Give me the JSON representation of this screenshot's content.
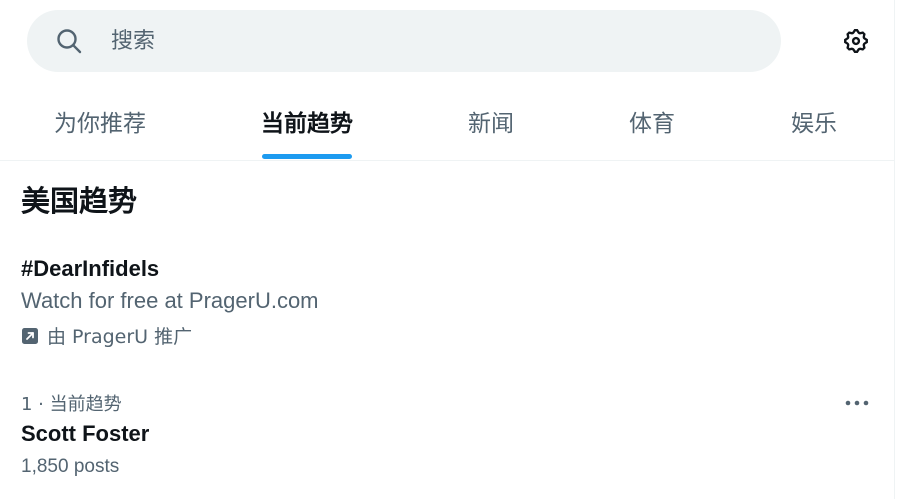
{
  "search": {
    "placeholder": "搜索",
    "icon": "search-icon"
  },
  "settings": {
    "icon": "gear-icon"
  },
  "tabs": [
    {
      "label": "为你推荐",
      "active": false
    },
    {
      "label": "当前趋势",
      "active": true
    },
    {
      "label": "新闻",
      "active": false
    },
    {
      "label": "体育",
      "active": false
    },
    {
      "label": "娱乐",
      "active": false
    }
  ],
  "section": {
    "title": "美国趋势"
  },
  "promoted": {
    "name": "#DearInfidels",
    "description": "Watch for free at PragerU.com",
    "promoted_by": "由 PragerU 推广",
    "icon": "promoted-icon"
  },
  "trends": [
    {
      "meta": "1 · 当前趋势",
      "name": "Scott Foster",
      "count": "1,850 posts"
    }
  ],
  "colors": {
    "accent": "#1d9bf0",
    "text_primary": "#0f1419",
    "text_secondary": "#536471",
    "search_bg": "#eff3f4"
  }
}
